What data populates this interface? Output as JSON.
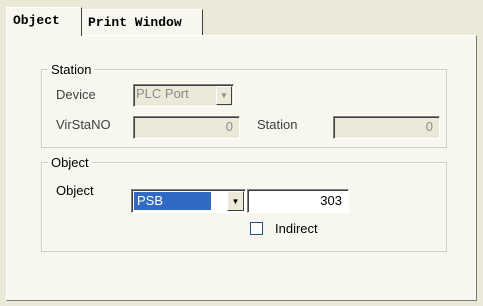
{
  "tabs": [
    {
      "label": "Object"
    },
    {
      "label": "Print Window"
    }
  ],
  "station": {
    "legend": "Station",
    "device_label": "Device",
    "device_value": "PLC Port",
    "virstano_label": "VirStaNO",
    "virstano_value": "0",
    "station_label": "Station",
    "station_value": "0"
  },
  "object": {
    "legend": "Object",
    "object_label": "Object",
    "object_type": "PSB",
    "object_value": "303",
    "indirect_label": "Indirect",
    "indirect_checked": false
  },
  "colors": {
    "selection": "#316ac5",
    "window_bg": "#ece9d8"
  }
}
